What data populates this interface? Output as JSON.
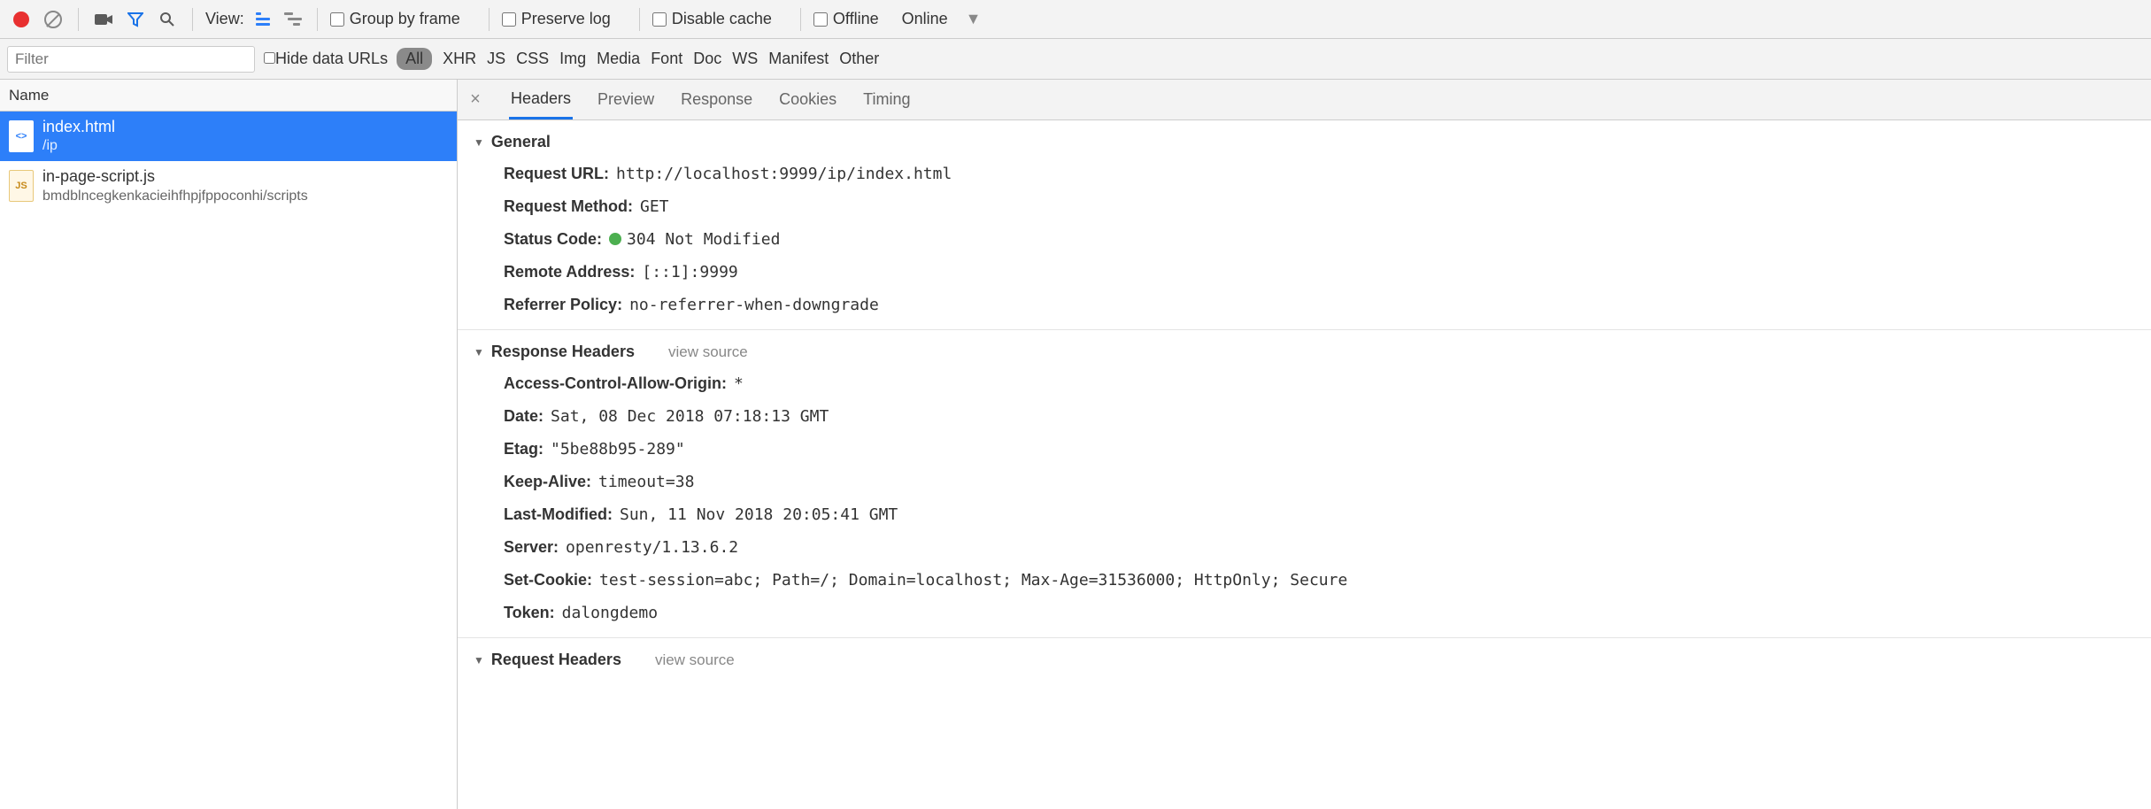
{
  "toolbar": {
    "view_label": "View:",
    "group_by_frame": "Group by frame",
    "preserve_log": "Preserve log",
    "disable_cache": "Disable cache",
    "offline": "Offline",
    "online": "Online"
  },
  "filter": {
    "placeholder": "Filter",
    "hide_data_urls": "Hide data URLs",
    "types": [
      "All",
      "XHR",
      "JS",
      "CSS",
      "Img",
      "Media",
      "Font",
      "Doc",
      "WS",
      "Manifest",
      "Other"
    ]
  },
  "left": {
    "header": "Name",
    "requests": [
      {
        "name": "index.html",
        "sub": "/ip",
        "icon": "<>",
        "selected": true
      },
      {
        "name": "in-page-script.js",
        "sub": "bmdblncegkenkacieihfhpjfppoconhi/scripts",
        "icon": "JS",
        "selected": false
      }
    ]
  },
  "tabs": {
    "items": [
      "Headers",
      "Preview",
      "Response",
      "Cookies",
      "Timing"
    ],
    "active": "Headers"
  },
  "general": {
    "title": "General",
    "rows": [
      {
        "k": "Request URL:",
        "v": "http://localhost:9999/ip/index.html"
      },
      {
        "k": "Request Method:",
        "v": "GET"
      },
      {
        "k": "Status Code:",
        "v": "304 Not Modified",
        "status": true
      },
      {
        "k": "Remote Address:",
        "v": "[::1]:9999"
      },
      {
        "k": "Referrer Policy:",
        "v": "no-referrer-when-downgrade"
      }
    ]
  },
  "response_headers": {
    "title": "Response Headers",
    "view_source": "view source",
    "rows": [
      {
        "k": "Access-Control-Allow-Origin:",
        "v": "*"
      },
      {
        "k": "Date:",
        "v": "Sat, 08 Dec 2018 07:18:13 GMT"
      },
      {
        "k": "Etag:",
        "v": "\"5be88b95-289\""
      },
      {
        "k": "Keep-Alive:",
        "v": "timeout=38"
      },
      {
        "k": "Last-Modified:",
        "v": "Sun, 11 Nov 2018 20:05:41 GMT"
      },
      {
        "k": "Server:",
        "v": "openresty/1.13.6.2"
      },
      {
        "k": "Set-Cookie:",
        "v": "test-session=abc; Path=/; Domain=localhost; Max-Age=31536000; HttpOnly; Secure"
      },
      {
        "k": "Token:",
        "v": "dalongdemo"
      }
    ]
  },
  "request_headers": {
    "title": "Request Headers",
    "view_source": "view source"
  }
}
